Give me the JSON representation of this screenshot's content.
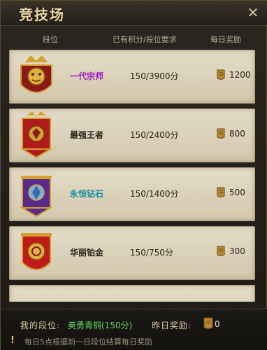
{
  "window": {
    "title": "竞技场"
  },
  "columns": {
    "rank": "段位",
    "points": "已有积分/段位要求",
    "reward": "每日奖励"
  },
  "ranks": [
    {
      "name": "一代宗师",
      "name_color": "#a020c0",
      "points": "150/3900分",
      "reward": "1200",
      "emblem": "golden-dragon-emblem-icon"
    },
    {
      "name": "最强王者",
      "name_color": "#2b2418",
      "points": "150/2400分",
      "reward": "800",
      "emblem": "red-banner-emblem-icon"
    },
    {
      "name": "永恒钻石",
      "name_color": "#1a8fa0",
      "points": "150/1400分",
      "reward": "500",
      "emblem": "purple-banner-emblem-icon"
    },
    {
      "name": "华丽铂金",
      "name_color": "#2b2418",
      "points": "150/750分",
      "reward": "300",
      "emblem": "red-shield-emblem-icon"
    }
  ],
  "footer": {
    "my_rank_label": "我的段位:",
    "my_rank_value": "英勇青铜(150分)",
    "yesterday_label": "昨日奖励:",
    "yesterday_value": "0",
    "notice": "每日5点根据前一日段位结算每日奖励"
  },
  "colors": {
    "accent_gold": "#e9d8a8",
    "positive_green": "#5fd25a"
  }
}
